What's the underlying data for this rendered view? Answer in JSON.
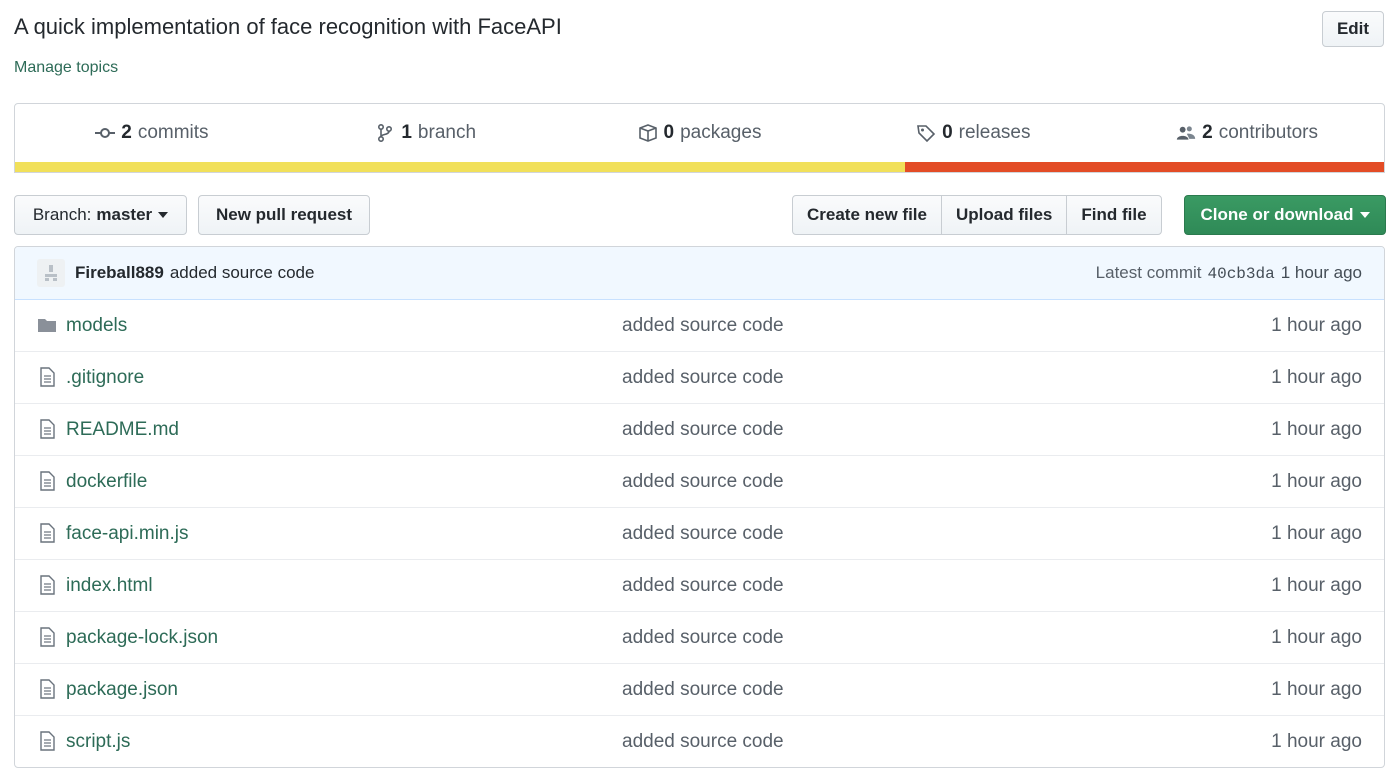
{
  "repo": {
    "description": "A quick implementation of face recognition with FaceAPI",
    "manage_topics": "Manage topics",
    "edit_label": "Edit"
  },
  "summary": {
    "commits": {
      "count": "2",
      "label": "commits"
    },
    "branches": {
      "count": "1",
      "label": "branch"
    },
    "packages": {
      "count": "0",
      "label": "packages"
    },
    "releases": {
      "count": "0",
      "label": "releases"
    },
    "contributors": {
      "count": "2",
      "label": "contributors"
    },
    "language_colors": [
      "#f1e05a",
      "#e34c26"
    ],
    "language_fractions": [
      0.65,
      0.35
    ]
  },
  "toolbar": {
    "branch_prefix": "Branch:",
    "branch_name": "master",
    "new_pr": "New pull request",
    "create_file": "Create new file",
    "upload_files": "Upload files",
    "find_file": "Find file",
    "clone": "Clone or download",
    "clone_color": "#2f8a57"
  },
  "latest_commit": {
    "author": "Fireball889",
    "message": "added source code",
    "label": "Latest commit",
    "sha": "40cb3da",
    "age": "1 hour ago"
  },
  "files": [
    {
      "name": "models",
      "type": "folder-icon",
      "message": "added source code",
      "age": "1 hour ago"
    },
    {
      "name": ".gitignore",
      "type": "file-icon",
      "message": "added source code",
      "age": "1 hour ago"
    },
    {
      "name": "README.md",
      "type": "file-icon",
      "message": "added source code",
      "age": "1 hour ago"
    },
    {
      "name": "dockerfile",
      "type": "file-icon",
      "message": "added source code",
      "age": "1 hour ago"
    },
    {
      "name": "face-api.min.js",
      "type": "file-icon",
      "message": "added source code",
      "age": "1 hour ago"
    },
    {
      "name": "index.html",
      "type": "file-icon",
      "message": "added source code",
      "age": "1 hour ago"
    },
    {
      "name": "package-lock.json",
      "type": "file-icon",
      "message": "added source code",
      "age": "1 hour ago"
    },
    {
      "name": "package.json",
      "type": "file-icon",
      "message": "added source code",
      "age": "1 hour ago"
    },
    {
      "name": "script.js",
      "type": "file-icon",
      "message": "added source code",
      "age": "1 hour ago"
    }
  ]
}
